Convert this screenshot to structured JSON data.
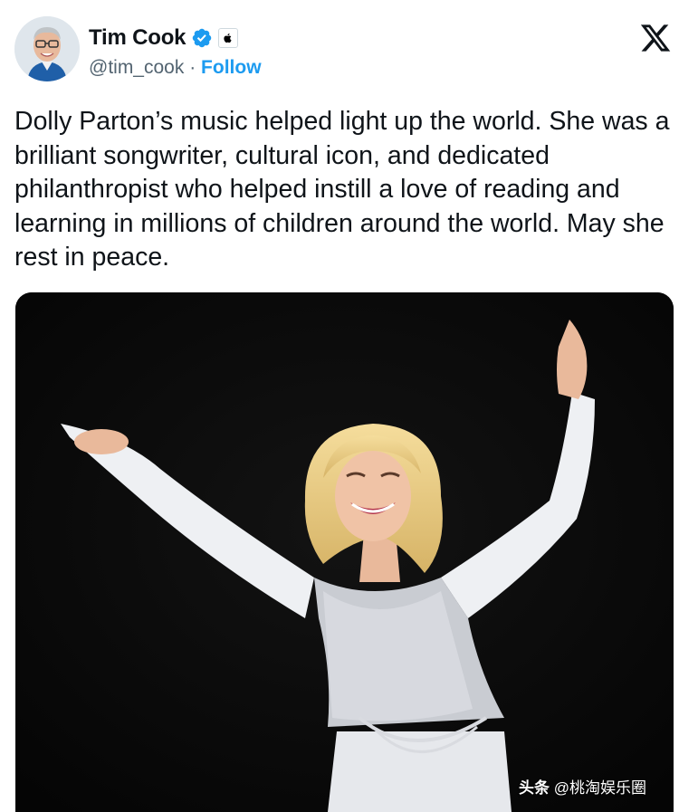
{
  "tweet": {
    "author": {
      "name": "Tim Cook",
      "handle": "@tim_cook",
      "separator": "·",
      "follow_label": "Follow",
      "verified": true,
      "affiliation_icon": "apple-icon"
    },
    "text": "Dolly Parton’s music helped light up the world. She was a brilliant songwriter, cultural icon, and dedicated philanthropist who helped instill a love of reading and learning in millions of children around the world. May she rest in peace.",
    "brand_icon": "x-logo-icon"
  },
  "watermark": {
    "brand": "头条",
    "account": "@桃淘娱乐圈"
  },
  "colors": {
    "accent": "#1d9bf0",
    "text": "#0f1419",
    "secondary_text": "#536471",
    "media_background": "#000000"
  }
}
